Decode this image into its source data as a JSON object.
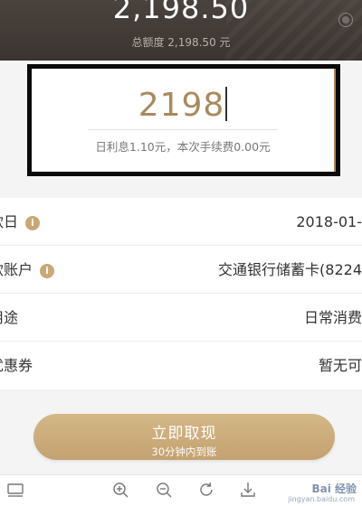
{
  "header": {
    "available_amount": "2,198.50",
    "total_label": "总额度 2,198.50 元"
  },
  "amount_card": {
    "input_value": "2198",
    "hint": "日利息1.10元，本次手续费0.00元"
  },
  "rows": [
    {
      "label": "款日",
      "value": "2018-01-",
      "has_info": true
    },
    {
      "label": "款账户",
      "value": "交通银行储蓄卡(8224",
      "has_info": true
    },
    {
      "label": "用途",
      "value": "日常消费",
      "has_info": false
    },
    {
      "label": "忧惠券",
      "value": "暂无可",
      "has_info": false
    }
  ],
  "withdraw_button": {
    "title": "立即取现",
    "subtitle": "30分钟内到账"
  },
  "toolbar": {
    "icons": [
      "layout-icon",
      "zoom-in-icon",
      "zoom-out-icon",
      "rotate-icon",
      "download-icon"
    ]
  },
  "watermark": {
    "text": "Bai 经验",
    "sub": "jingyan.baidu.com"
  },
  "colors": {
    "header_bg": "#3b3430",
    "accent_gold": "#c8a874",
    "amount_text": "#a88a5e"
  }
}
